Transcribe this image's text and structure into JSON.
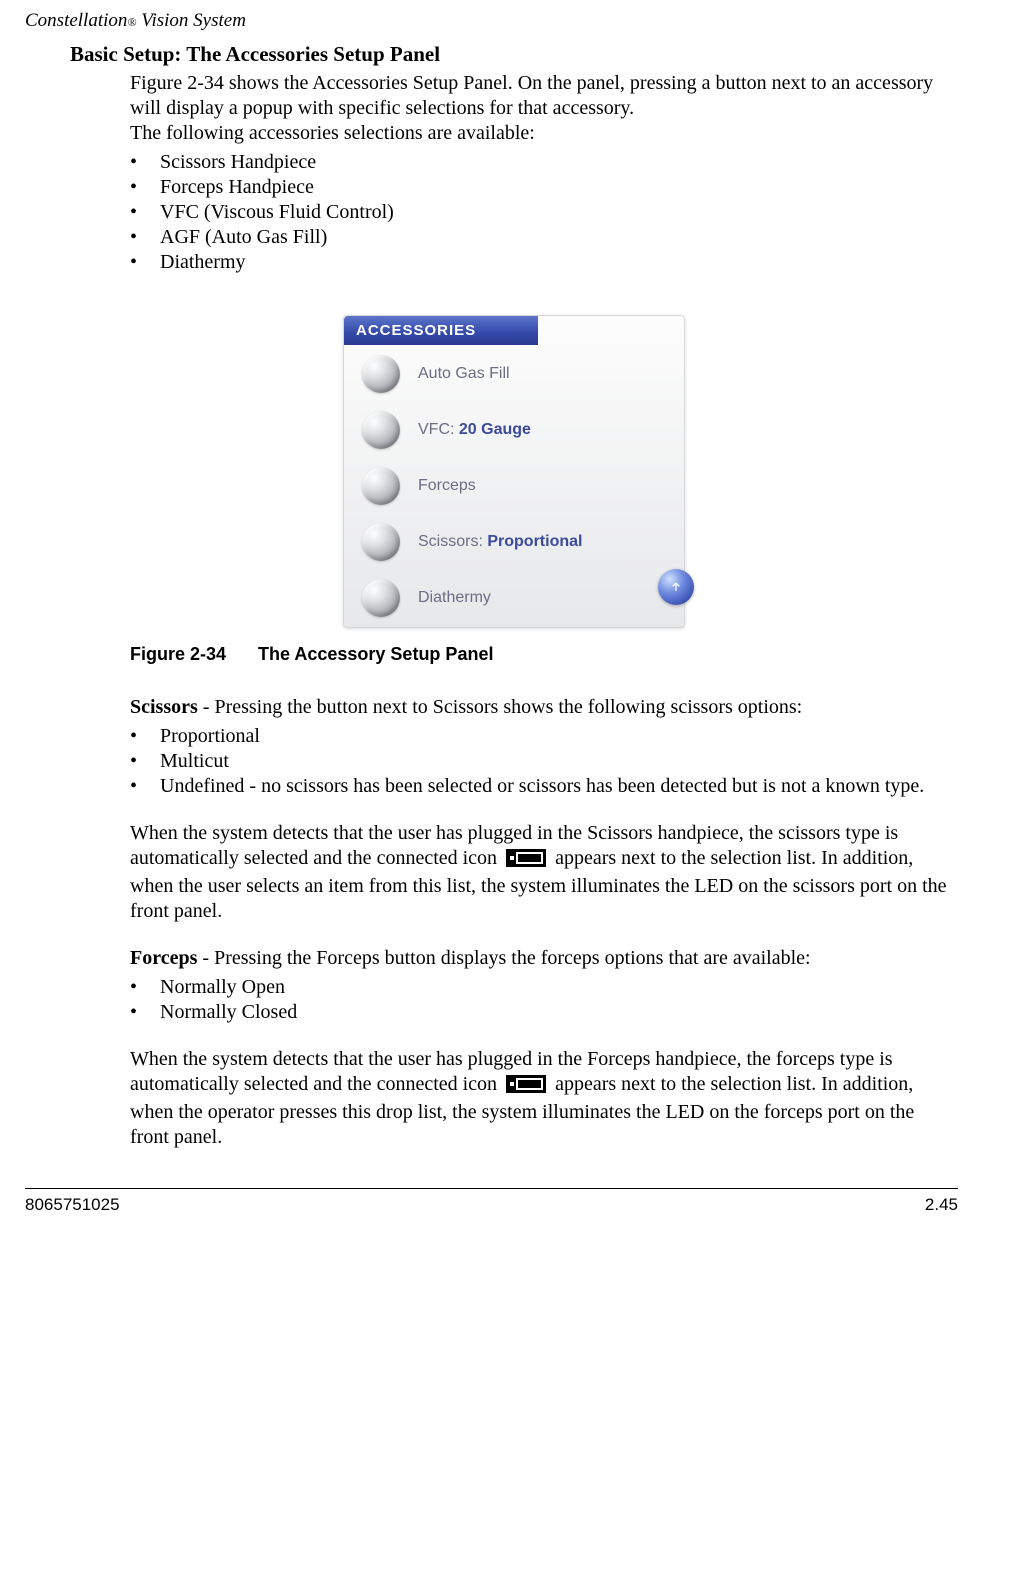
{
  "header": {
    "product": "Constellation",
    "reg": "®",
    "suffix": " Vision System"
  },
  "section": {
    "heading": "Basic Setup: The Accessories Setup Panel",
    "intro1": "Figure 2-34 shows the Accessories Setup Panel. On the panel, pressing a button next to an accessory will display a popup with specific selections for that accessory.",
    "intro2": "The following accessories selections are available:",
    "accessories": [
      "Scissors Handpiece",
      "Forceps Handpiece",
      "VFC (Viscous Fluid Control)",
      "AGF (Auto Gas Fill)",
      "Diathermy"
    ]
  },
  "panel": {
    "title": "ACCESSORIES",
    "rows": [
      {
        "label": "Auto Gas Fill",
        "value": ""
      },
      {
        "label": "VFC: ",
        "value": "20 Gauge"
      },
      {
        "label": "Forceps",
        "value": ""
      },
      {
        "label": "Scissors:  ",
        "value": "Proportional"
      },
      {
        "label": "Diathermy",
        "value": ""
      }
    ]
  },
  "figure": {
    "num": "Figure 2-34",
    "title": "The Accessory Setup Panel"
  },
  "scissors": {
    "title": "Scissors",
    "lede": " - Pressing the button next to Scissors shows the following scissors options:",
    "options": [
      "Proportional",
      "Multicut",
      "Undefined - no scissors has been selected or scissors has been detected but is not a known type."
    ],
    "para_a": "When the system detects that the user has plugged in the Scissors handpiece, the scissors type is automatically selected and the connected icon ",
    "para_b": " appears next to the selection list. In addition, when the user selects an item from this list, the system illuminates the LED on the scissors port on the front panel."
  },
  "forceps": {
    "title": "Forceps",
    "lede": " -  Pressing the Forceps button displays the forceps options that are available:",
    "options": [
      "Normally Open",
      "Normally Closed"
    ],
    "para_a": "When the system detects that the user has plugged in the Forceps handpiece, the forceps type is automatically selected and the connected icon ",
    "para_b": " appears next to the selection list. In addition, when the operator presses this drop list, the system illuminates the LED on the forceps port on the front panel."
  },
  "footer": {
    "left": "8065751025",
    "right": "2.45"
  }
}
